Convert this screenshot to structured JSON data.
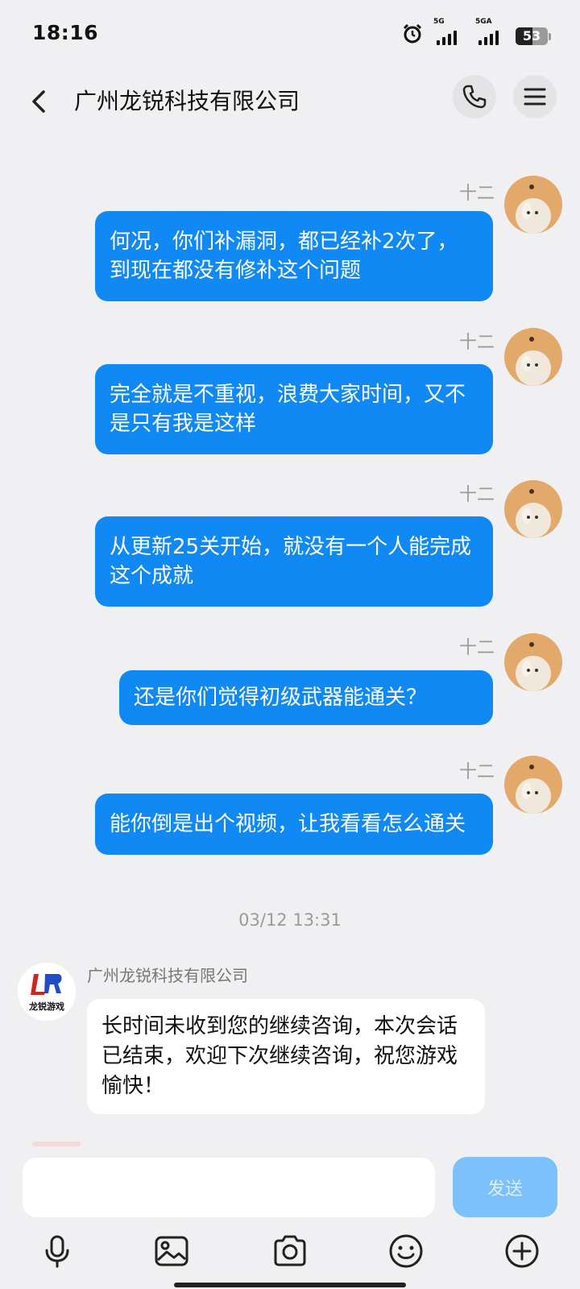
{
  "status_bar": {
    "time": "18:16",
    "net1": "5G",
    "net2": "5GA",
    "battery": "53",
    "battery_level_percent": 53
  },
  "header": {
    "title": "广州龙锐科技有限公司"
  },
  "messages": [
    {
      "timestamp": "十二",
      "text": "何况，你们补漏洞，都已经补2次了，到现在都没有修补这个问题"
    },
    {
      "timestamp": "十二",
      "text": "完全就是不重视，浪费大家时间，又不是只有我是这样"
    },
    {
      "timestamp": "十二",
      "text": "从更新25关开始，就没有一个人能完成这个成就"
    },
    {
      "timestamp": "十二",
      "text": "还是你们觉得初级武器能通关？"
    },
    {
      "timestamp": "十二",
      "text": "能你倒是出个视频，让我看看怎么通关"
    }
  ],
  "date_separator": "03/12 13:31",
  "incoming": {
    "sender": "广州龙锐科技有限公司",
    "logo_text": "龙锐游戏",
    "text": "长时间未收到您的继续咨询，本次会话已结束，欢迎下次继续咨询，祝您游戏愉快！"
  },
  "input": {
    "placeholder": "",
    "send_label": "发送"
  },
  "colors": {
    "bubble_out": "#1189f5",
    "send_disabled": "#7cc1fb",
    "background": "#f0f0f2"
  },
  "toolbar_icons": [
    "microphone-icon",
    "image-icon",
    "camera-icon",
    "emoji-icon",
    "plus-icon"
  ]
}
